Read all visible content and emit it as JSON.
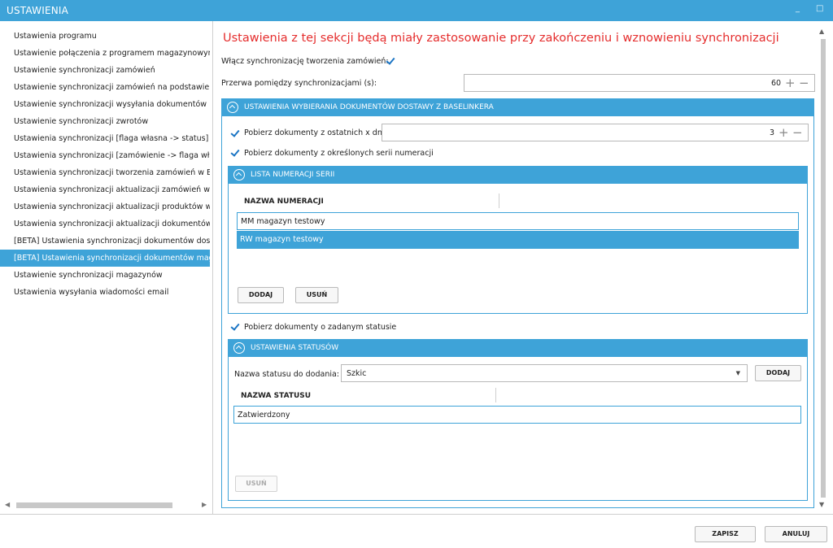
{
  "window": {
    "title": "USTAWIENIA",
    "minimize_icon": "_",
    "restore_icon": "□"
  },
  "sidebar": {
    "items": [
      {
        "label": "Ustawienia programu"
      },
      {
        "label": "Ustawienie połączenia z programem magazynowym"
      },
      {
        "label": "Ustawienie synchronizacji zamówień"
      },
      {
        "label": "Ustawienie synchronizacji zamówień na podstawie dzi"
      },
      {
        "label": "Ustawienie synchronizacji wysyłania dokumentów"
      },
      {
        "label": "Ustawienie synchronizacji zwrotów"
      },
      {
        "label": "Ustawienia synchronizacji [flaga własna -> status]"
      },
      {
        "label": "Ustawienia synchronizacji [zamówienie -> flaga własn"
      },
      {
        "label": "Ustawienia synchronizacji tworzenia zamówień w Base"
      },
      {
        "label": "Ustawienia synchronizacji aktualizacji zamówień w Bas"
      },
      {
        "label": "Ustawienia synchronizacji aktualizacji produktów w Ba"
      },
      {
        "label": "Ustawienia synchronizacji aktualizacji dokumentów"
      },
      {
        "label": "[BETA] Ustawienia synchronizacji dokumentów dostaw"
      },
      {
        "label": "[BETA] Ustawienia synchronizacji dokumentów magaz"
      },
      {
        "label": "Ustawienie synchronizacji magazynów"
      },
      {
        "label": "Ustawienia wysyłania wiadomości email"
      }
    ],
    "selected_index": 13,
    "scroll_left_icon": "◀",
    "scroll_right_icon": "▶"
  },
  "main": {
    "headline": "Ustawienia z tej sekcji będą miały zastosowanie przy zakończeniu i wznowieniu synchronizacji",
    "enable_sync_label": "Włącz synchronizację tworzenia zamówień:",
    "enable_sync_checked": true,
    "interval_label": "Przerwa pomiędzy synchronizacjami (s):",
    "interval_value": "60",
    "plus_icon": "+",
    "minus_icon": "−",
    "scroll_up_icon": "▲",
    "scroll_down_icon": "▼"
  },
  "delivery_section": {
    "header": "USTAWIENIA WYBIERANIA DOKUMENTÓW DOSTAWY Z BASELINKERA",
    "last_days_label": "Pobierz dokumenty z ostatnich x dni",
    "last_days_checked": true,
    "last_days_value": "3",
    "series_label": "Pobierz dokumenty z określonych serii numeracji",
    "series_checked": true,
    "series_list": {
      "header": "LISTA NUMERACJI SERII",
      "column": "NAZWA NUMERACJI",
      "rows": [
        "MM magazyn testowy",
        "RW magazyn testowy"
      ],
      "selected_row": 1,
      "add_label": "DODAJ",
      "remove_label": "USUŃ"
    },
    "status_label": "Pobierz dokumenty o zadanym statusie",
    "status_checked": true
  },
  "status_section": {
    "header": "USTAWIENIA STATUSÓW",
    "status_name_label": "Nazwa statusu do dodania:",
    "status_value": "Szkic",
    "dropdown_icon": "▼",
    "add_label": "DODAJ",
    "column": "NAZWA STATUSU",
    "rows": [
      "Zatwierdzony"
    ],
    "remove_label": "USUŃ"
  },
  "footer": {
    "save_label": "ZAPISZ",
    "cancel_label": "ANULUJ"
  },
  "colors": {
    "accent": "#3ea3d8",
    "headline": "#e52d2d",
    "check": "#1b75c4"
  }
}
